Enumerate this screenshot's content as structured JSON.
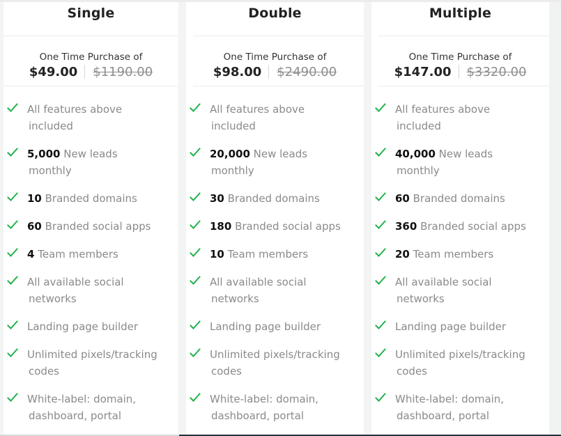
{
  "colors": {
    "check": "#22b14c",
    "feature_text": "#8a8a8a",
    "number_text": "#111111",
    "title_text": "#222222"
  },
  "plans": [
    {
      "title": "Single",
      "price_label": "One Time Purchase of",
      "price": "$49.00",
      "original_price": "$1190.00",
      "features": [
        {
          "icon": "check-icon",
          "num": "",
          "text": "All features above",
          "cont": "included"
        },
        {
          "icon": "check-icon",
          "num": "5,000",
          "text": " New leads",
          "cont": "monthly"
        },
        {
          "icon": "check-icon",
          "num": "10",
          "text": " Branded domains",
          "cont": ""
        },
        {
          "icon": "check-icon",
          "num": "60",
          "text": " Branded social apps",
          "cont": ""
        },
        {
          "icon": "check-icon",
          "num": "4",
          "text": " Team members",
          "cont": ""
        },
        {
          "icon": "check-icon",
          "num": "",
          "text": "All available social",
          "cont": "networks"
        },
        {
          "icon": "check-icon",
          "num": "",
          "text": "Landing page builder",
          "cont": ""
        },
        {
          "icon": "check-icon",
          "num": "",
          "text": "Unlimited pixels/tracking",
          "cont": "codes"
        },
        {
          "icon": "check-icon",
          "num": "",
          "text": "White-label: domain,",
          "cont": "dashboard, portal"
        }
      ]
    },
    {
      "title": "Double",
      "price_label": "One Time Purchase of",
      "price": "$98.00",
      "original_price": "$2490.00",
      "features": [
        {
          "icon": "check-icon",
          "num": "",
          "text": "All features above",
          "cont": "included"
        },
        {
          "icon": "check-icon",
          "num": "20,000",
          "text": " New leads",
          "cont": "monthly"
        },
        {
          "icon": "check-icon",
          "num": "30",
          "text": " Branded domains",
          "cont": ""
        },
        {
          "icon": "check-icon",
          "num": "180",
          "text": " Branded social apps",
          "cont": ""
        },
        {
          "icon": "check-icon",
          "num": "10",
          "text": " Team members",
          "cont": ""
        },
        {
          "icon": "check-icon",
          "num": "",
          "text": "All available social",
          "cont": "networks"
        },
        {
          "icon": "check-icon",
          "num": "",
          "text": "Landing page builder",
          "cont": ""
        },
        {
          "icon": "check-icon",
          "num": "",
          "text": "Unlimited pixels/tracking",
          "cont": "codes"
        },
        {
          "icon": "check-icon",
          "num": "",
          "text": "White-label: domain,",
          "cont": "dashboard, portal"
        }
      ]
    },
    {
      "title": "Multiple",
      "price_label": "One Time Purchase of",
      "price": "$147.00",
      "original_price": "$3320.00",
      "features": [
        {
          "icon": "check-icon",
          "num": "",
          "text": "All features above",
          "cont": "included"
        },
        {
          "icon": "check-icon",
          "num": "40,000",
          "text": " New leads",
          "cont": "monthly"
        },
        {
          "icon": "check-icon",
          "num": "60",
          "text": " Branded domains",
          "cont": ""
        },
        {
          "icon": "check-icon",
          "num": "360",
          "text": " Branded social apps",
          "cont": ""
        },
        {
          "icon": "check-icon",
          "num": "20",
          "text": " Team members",
          "cont": ""
        },
        {
          "icon": "check-icon",
          "num": "",
          "text": "All available social",
          "cont": "networks"
        },
        {
          "icon": "check-icon",
          "num": "",
          "text": "Landing page builder",
          "cont": ""
        },
        {
          "icon": "check-icon",
          "num": "",
          "text": "Unlimited pixels/tracking",
          "cont": "codes"
        },
        {
          "icon": "check-icon",
          "num": "",
          "text": "White-label: domain,",
          "cont": "dashboard, portal"
        }
      ]
    }
  ]
}
